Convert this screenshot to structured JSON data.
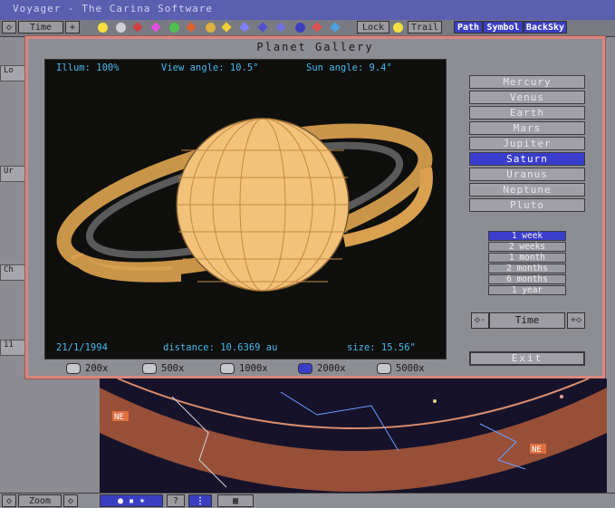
{
  "window": {
    "title": "Voyager - The Carina Software"
  },
  "toolbar": {
    "time_label": "Time",
    "lock_label": "Lock",
    "trail_label": "Trail",
    "path_label": "Path",
    "symbol_label": "Symbol",
    "backsky_label": "BackSky"
  },
  "dialog": {
    "title": "Planet Gallery",
    "illum": "Illum: 100%",
    "view_angle": "View angle: 10.5°",
    "sun_angle": "Sun angle: 9.4°",
    "date": "21/1/1994",
    "distance": "distance: 10.6369 au",
    "size": "size: 15.56\"",
    "planets": [
      "Mercury",
      "Venus",
      "Earth",
      "Mars",
      "Jupiter",
      "Saturn",
      "Uranus",
      "Neptune",
      "Pluto"
    ],
    "selected_planet": "Saturn",
    "periods": [
      "1 week",
      "2 weeks",
      "1 month",
      "2 months",
      "6 months",
      "1 year"
    ],
    "selected_period": "1 week",
    "time_label": "Time",
    "exit_label": "Exit",
    "magnifications": [
      "200x",
      "500x",
      "1000x",
      "2000x",
      "5000x"
    ],
    "selected_magnification": "2000x"
  },
  "sky": {
    "marker_left": "NE",
    "marker_right": "NE"
  },
  "bottom": {
    "zoom_label": "Zoom"
  },
  "colors": {
    "accent": "#3a3ecc",
    "dialog_border": "#d8867e",
    "info_text": "#48b8ec",
    "planet": "#f0c77a"
  }
}
